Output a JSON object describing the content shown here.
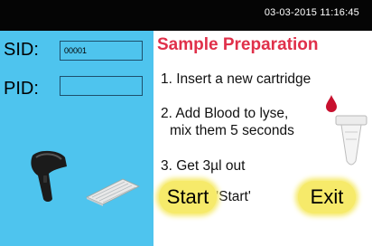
{
  "status_bar": {
    "datetime": "03-03-2015 11:16:45"
  },
  "fields": {
    "sid": {
      "label": "SID:",
      "value": "00001"
    },
    "pid": {
      "label": "PID:",
      "value": ""
    }
  },
  "instructions": {
    "title": "Sample Preparation",
    "steps": [
      "1. Insert a new cartridge",
      "2. Add Blood to lyse,",
      "mix them 5 seconds",
      "3. Get 3µl  out",
      "4. Press 'Start'"
    ]
  },
  "buttons": {
    "start": "Start",
    "exit": "Exit"
  },
  "colors": {
    "left_panel": "#4ec4ee",
    "title": "#e0304a",
    "button": "#f6ea6a"
  },
  "icons": [
    "barcode-scanner-icon",
    "keyboard-icon",
    "blood-drop-icon",
    "test-tube-icon"
  ]
}
